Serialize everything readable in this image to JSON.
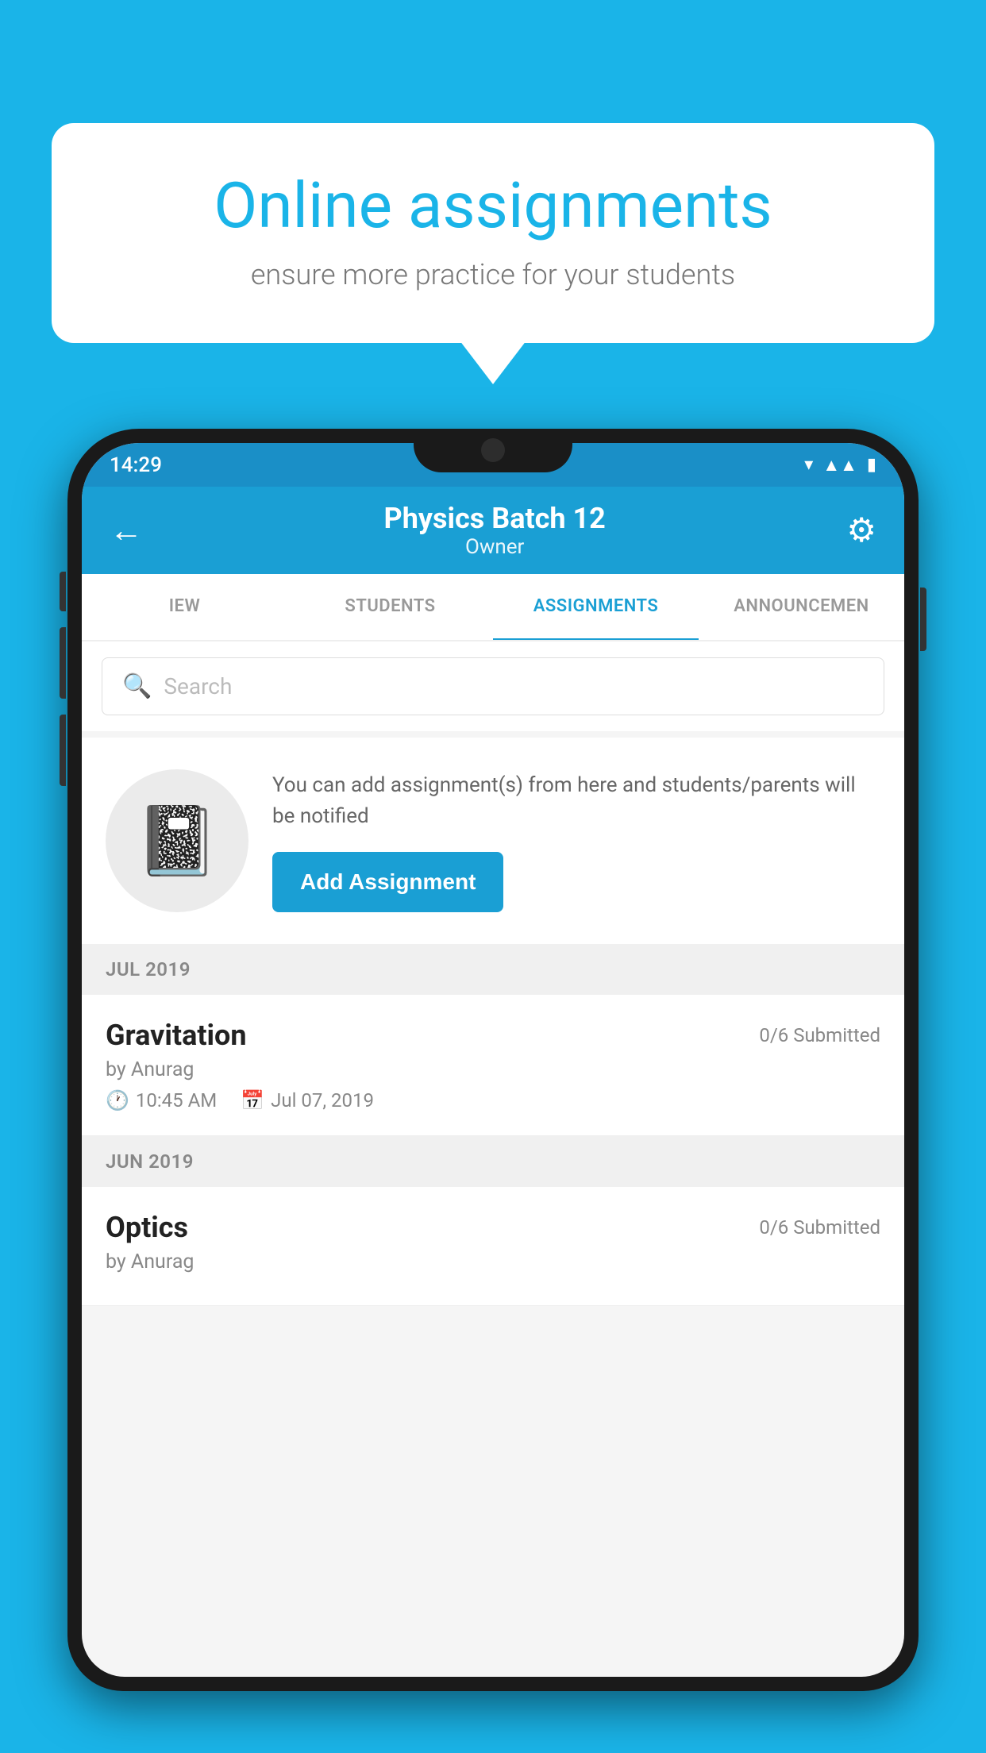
{
  "background_color": "#1ab4e8",
  "speech_bubble": {
    "title": "Online assignments",
    "subtitle": "ensure more practice for your students"
  },
  "status_bar": {
    "time": "14:29",
    "icons": [
      "wifi",
      "signal",
      "battery"
    ]
  },
  "app_bar": {
    "title": "Physics Batch 12",
    "subtitle": "Owner",
    "back_label": "←",
    "settings_label": "⚙"
  },
  "tabs": [
    {
      "label": "IEW",
      "active": false
    },
    {
      "label": "STUDENTS",
      "active": false
    },
    {
      "label": "ASSIGNMENTS",
      "active": true
    },
    {
      "label": "ANNOUNCEMEN",
      "active": false
    }
  ],
  "search": {
    "placeholder": "Search"
  },
  "add_assignment_card": {
    "description": "You can add assignment(s) from here and students/parents will be notified",
    "button_label": "Add Assignment"
  },
  "sections": [
    {
      "header": "JUL 2019",
      "assignments": [
        {
          "name": "Gravitation",
          "submitted": "0/6 Submitted",
          "author": "by Anurag",
          "time": "10:45 AM",
          "date": "Jul 07, 2019"
        }
      ]
    },
    {
      "header": "JUN 2019",
      "assignments": [
        {
          "name": "Optics",
          "submitted": "0/6 Submitted",
          "author": "by Anurag",
          "time": "",
          "date": ""
        }
      ]
    }
  ]
}
